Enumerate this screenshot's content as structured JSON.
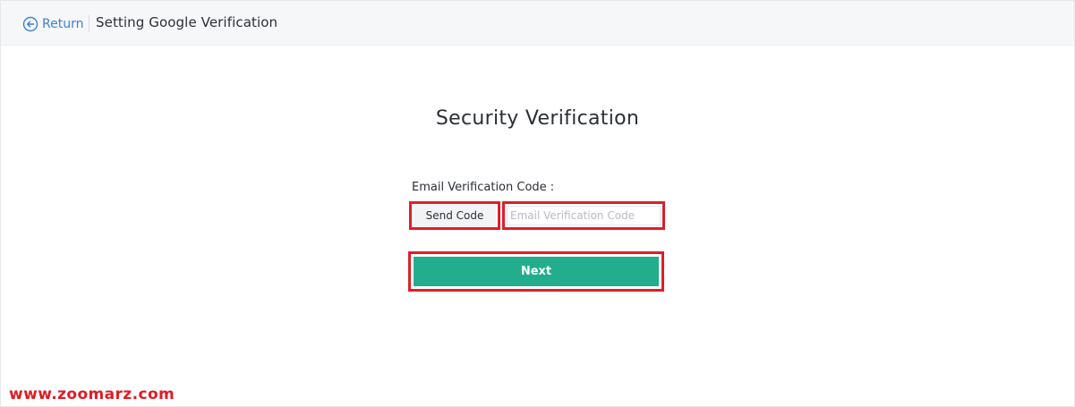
{
  "header": {
    "return_label": "Return",
    "title": "Setting Google Verification",
    "return_icon": "arrow-left-circle-icon"
  },
  "main": {
    "heading": "Security Verification",
    "email_code": {
      "label": "Email Verification Code :",
      "send_button_label": "Send Code",
      "input_placeholder": "Email Verification Code",
      "input_value": ""
    },
    "next_button_label": "Next"
  },
  "highlight_color": "#dc1f2b",
  "accent_color": "#22ad8c",
  "link_color": "#3b7fd6",
  "watermark": "www.zoomarz.com"
}
